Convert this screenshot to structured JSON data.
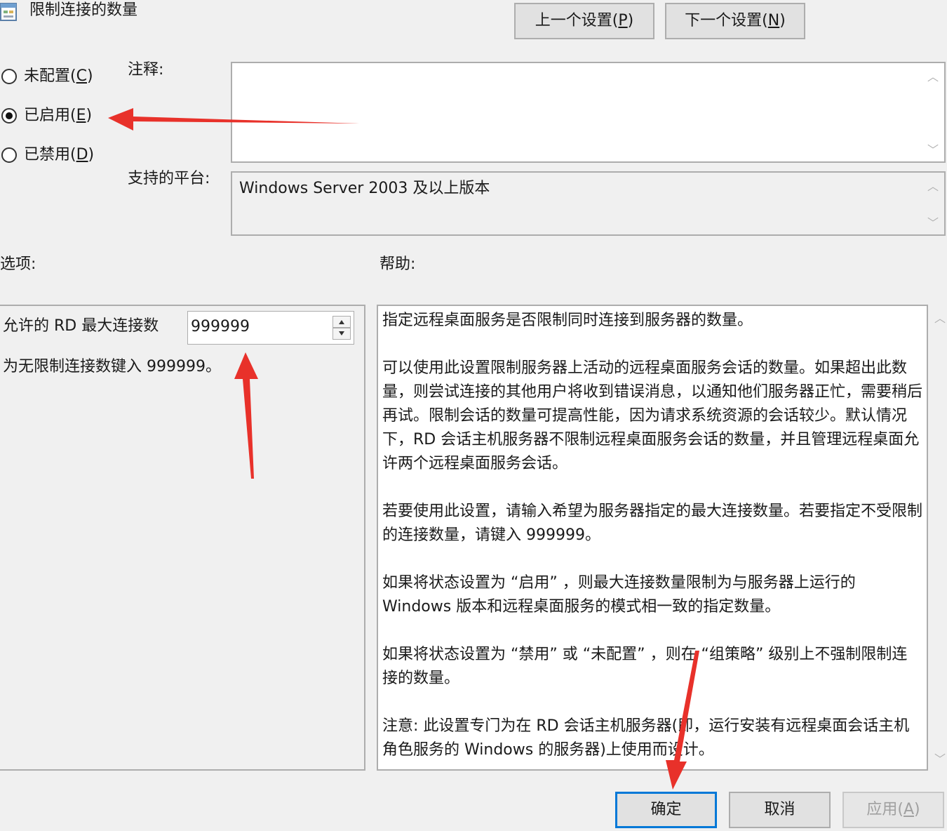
{
  "window": {
    "title": "限制连接的数量"
  },
  "nav": {
    "prev": "上一个设置(P)",
    "prev_pre": "上一个设置(",
    "prev_key": "P",
    "next_pre": "下一个设置(",
    "next_key": "N"
  },
  "state": {
    "options": [
      {
        "pre": "未配置(",
        "key": "C",
        "checked": false
      },
      {
        "pre": "已启用(",
        "key": "E",
        "checked": true
      },
      {
        "pre": "已禁用(",
        "key": "D",
        "checked": false
      }
    ]
  },
  "comment": {
    "label": "注释:",
    "value": ""
  },
  "platform": {
    "label": "支持的平台:",
    "value": "Windows Server 2003 及以上版本"
  },
  "options_panel": {
    "label": "选项:",
    "field_label": "允许的 RD 最大连接数",
    "field_value": "999999",
    "hint": "为无限制连接数键入 999999。"
  },
  "help": {
    "label": "帮助:",
    "paragraphs": [
      "指定远程桌面服务是否限制同时连接到服务器的数量。",
      "可以使用此设置限制服务器上活动的远程桌面服务会话的数量。如果超出此数量，则尝试连接的其他用户将收到错误消息，以通知他们服务器正忙，需要稍后再试。限制会话的数量可提高性能，因为请求系统资源的会话较少。默认情况下，RD 会话主机服务器不限制远程桌面服务会话的数量，并且管理远程桌面允许两个远程桌面服务会话。",
      "若要使用此设置，请输入希望为服务器指定的最大连接数量。若要指定不受限制的连接数量，请键入 999999。",
      "如果将状态设置为 “启用” ，则最大连接数量限制为与服务器上运行的 Windows 版本和远程桌面服务的模式相一致的指定数量。",
      "如果将状态设置为 “禁用” 或 “未配置” ，则在 “组策略” 级别上不强制限制连接的数量。",
      "注意: 此设置专门为在 RD 会话主机服务器(即，运行安装有远程桌面会话主机角色服务的 Windows 的服务器)上使用而设计。"
    ]
  },
  "footer": {
    "ok": "确定",
    "cancel": "取消",
    "apply_pre": "应用(",
    "apply_key": "A"
  },
  "colors": {
    "accent": "#0078d7",
    "annotation_arrow": "#e8312a"
  }
}
